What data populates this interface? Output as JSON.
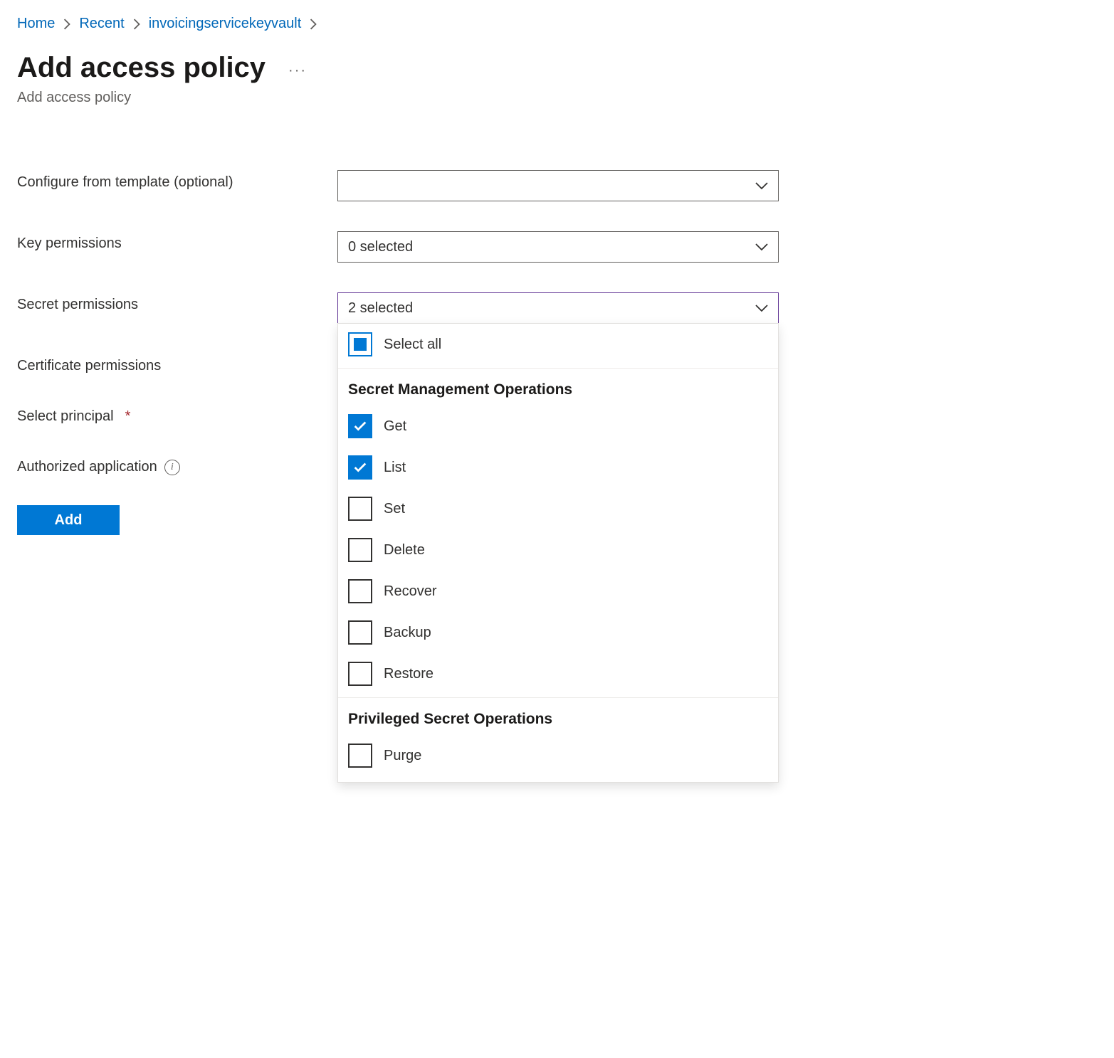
{
  "breadcrumb": {
    "items": [
      {
        "label": "Home"
      },
      {
        "label": "Recent"
      },
      {
        "label": "invoicingservicekeyvault"
      }
    ]
  },
  "header": {
    "title": "Add access policy",
    "subtitle": "Add access policy",
    "more_label": "···"
  },
  "labels": {
    "configure_template": "Configure from template (optional)",
    "key_permissions": "Key permissions",
    "secret_permissions": "Secret permissions",
    "certificate_permissions": "Certificate permissions",
    "select_principal": "Select principal",
    "authorized_application": "Authorized application"
  },
  "selects": {
    "configure_template": {
      "value": ""
    },
    "key_permissions": {
      "value": "0 selected"
    },
    "secret_permissions": {
      "value": "2 selected"
    }
  },
  "secret_dropdown": {
    "select_all_label": "Select all",
    "select_all_state": "indeterminate",
    "groups": [
      {
        "title": "Secret Management Operations",
        "options": [
          {
            "label": "Get",
            "checked": true
          },
          {
            "label": "List",
            "checked": true
          },
          {
            "label": "Set",
            "checked": false
          },
          {
            "label": "Delete",
            "checked": false
          },
          {
            "label": "Recover",
            "checked": false
          },
          {
            "label": "Backup",
            "checked": false
          },
          {
            "label": "Restore",
            "checked": false
          }
        ]
      },
      {
        "title": "Privileged Secret Operations",
        "options": [
          {
            "label": "Purge",
            "checked": false
          }
        ]
      }
    ]
  },
  "buttons": {
    "add": "Add"
  },
  "colors": {
    "primary": "#0078d4",
    "link": "#0067b8",
    "active_border": "#5c2e91"
  }
}
